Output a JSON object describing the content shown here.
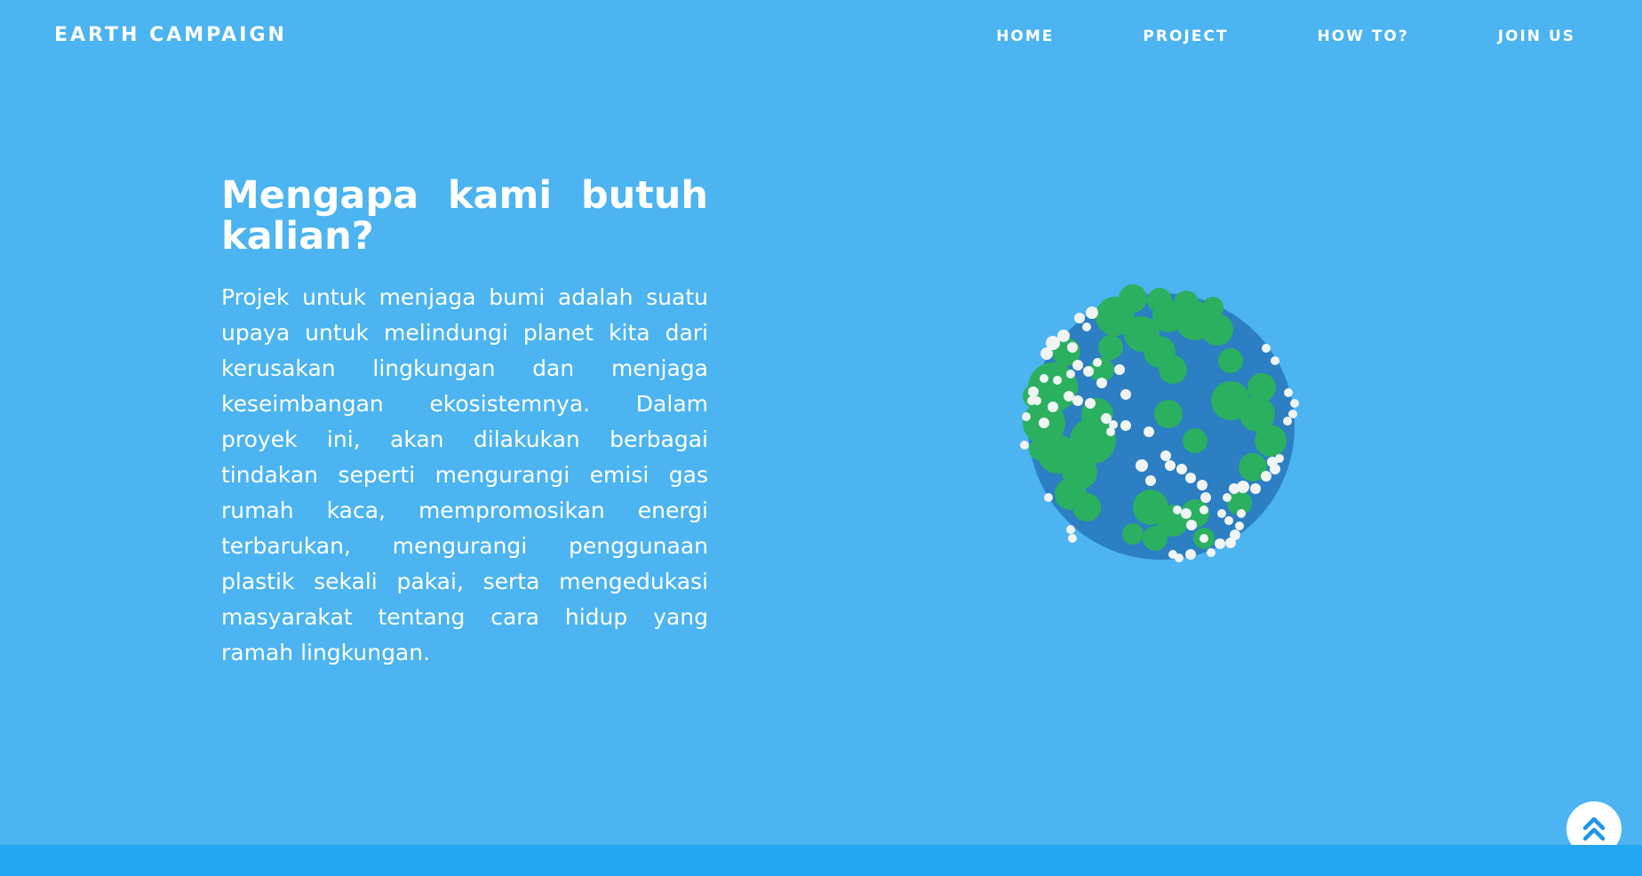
{
  "header": {
    "brand": "EARTH CAMPAIGN",
    "nav": [
      {
        "label": "HOME"
      },
      {
        "label": "PROJECT"
      },
      {
        "label": "HOW TO?"
      },
      {
        "label": "JOIN US"
      }
    ]
  },
  "main": {
    "heading": "Mengapa kami butuh kalian?",
    "paragraph": "Projek untuk menjaga bumi adalah suatu upaya untuk melindungi planet kita dari kerusakan lingkungan dan menjaga keseimbangan ekosistemnya. Dalam proyek ini, akan dilakukan berbagai tindakan seperti mengurangi emisi gas rumah kaca, mempromosikan energi terbarukan, mengurangi penggunaan plastik sekali pakai, serta mengedukasi masyarakat tentang cara hidup yang ramah lingkungan."
  },
  "icons": {
    "globe": "globe-illustration",
    "back_to_top": "double-chevron-up-icon"
  },
  "colors": {
    "background": "#4bb4f1",
    "footer_strip": "#23a6f0",
    "ocean": "#2b7fc2",
    "land": "#2bb060",
    "cloud": "#f0f4f2",
    "button_icon": "#1d96e8"
  }
}
